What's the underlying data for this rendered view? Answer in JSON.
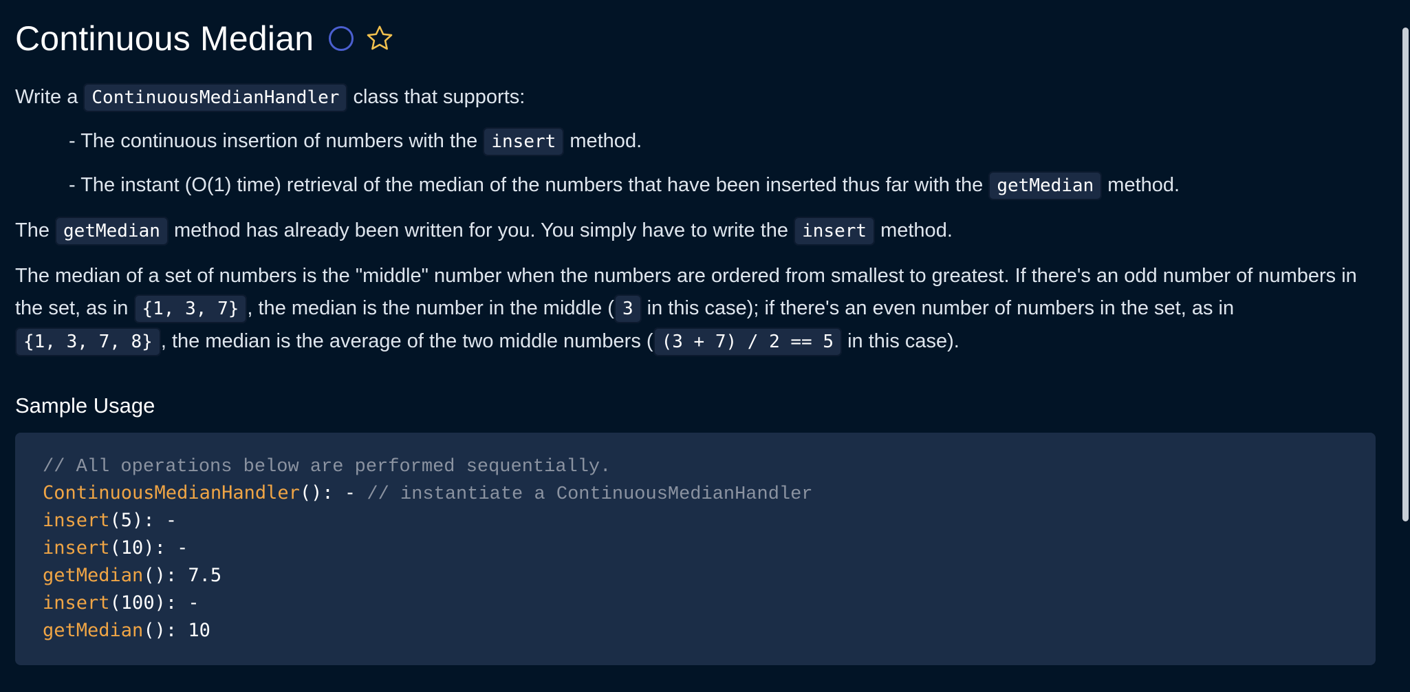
{
  "problem": {
    "title": "Continuous Median",
    "status_icon": "circle-icon",
    "favorite_icon": "star-icon"
  },
  "description": {
    "p1": {
      "before": "Write a ",
      "code": "ContinuousMedianHandler",
      "after": " class that supports:"
    },
    "bullet1": {
      "before": "- The continuous insertion of numbers with the ",
      "code": "insert",
      "after": " method."
    },
    "bullet2": {
      "before": "- The instant (O(1) time) retrieval of the median of the numbers that have been inserted thus far with the ",
      "code": "getMedian",
      "after": " method."
    },
    "p2": {
      "before": "The ",
      "code1": "getMedian",
      "middle": " method has already been written for you. You simply have to write the ",
      "code2": "insert",
      "after": " method."
    },
    "p3": {
      "t1": "The median of a set of numbers is the \"middle\" number when the numbers are ordered from smallest to greatest. If there's an odd number of numbers in the set, as in ",
      "c1": "{1, 3, 7}",
      "t2": ", the median is the number in the middle (",
      "c2": "3",
      "t3": " in this case); if there's an even number of numbers in the set, as in ",
      "c3": "{1, 3, 7, 8}",
      "t4": ", the median is the average of the two middle numbers (",
      "c4": "(3 + 7) / 2 == 5",
      "t5": " in this case)."
    }
  },
  "sample": {
    "heading": "Sample Usage",
    "lines": [
      {
        "comment": "// All operations below are performed sequentially."
      },
      {
        "fn": "ContinuousMedianHandler",
        "rest": "(): - ",
        "comment": "// instantiate a ContinuousMedianHandler"
      },
      {
        "fn": "insert",
        "rest": "(5): -"
      },
      {
        "fn": "insert",
        "rest": "(10): -"
      },
      {
        "fn": "getMedian",
        "rest": "(): 7.5"
      },
      {
        "fn": "insert",
        "rest": "(100): -"
      },
      {
        "fn": "getMedian",
        "rest": "(): 10"
      }
    ]
  },
  "colors": {
    "background": "#021426",
    "code_bg": "#1b2d47",
    "accent_orange": "#f0a545",
    "status_circle": "#4b5fd0",
    "star": "#f2c14e"
  }
}
